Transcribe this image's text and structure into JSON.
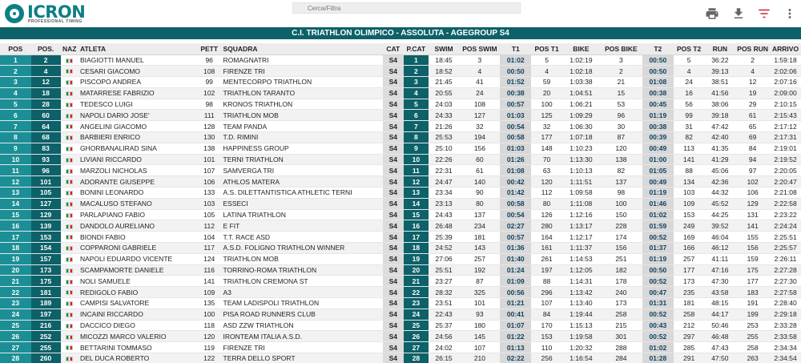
{
  "brand": {
    "name": "ICRON",
    "tagline": "PROFESSIONAL TIMING"
  },
  "search": {
    "placeholder": "Cerca/Filtra"
  },
  "title": "C.I. TRIATHLON OLIMPICO - ASSOLUTA - AGEGROUP S4",
  "icons": {
    "print": "print-icon",
    "download": "download-icon",
    "filter": "filter-icon",
    "menu": "menu-icon"
  },
  "colors": {
    "brand": "#0d7f86",
    "title_bar": "#0d6168",
    "pos_cell": "#1c8f96",
    "filter_icon": "#d2232a"
  },
  "headers": [
    "POS",
    "POS.",
    "NAZ",
    "ATLETA",
    "PETT",
    "SQUADRA",
    "CAT",
    "P.CAT",
    "SWIM",
    "POS SWIM",
    "T1",
    "POS T1",
    "BIKE",
    "POS BIKE",
    "T2",
    "POS T2",
    "RUN",
    "POS RUN",
    "ARRIVO"
  ],
  "rows": [
    [
      "1",
      "2",
      "",
      "BIAGIOTTI MANUEL",
      "96",
      "ROMAGNATRI",
      "S4",
      "1",
      "18:45",
      "3",
      "01:02",
      "5",
      "1:02:19",
      "3",
      "00:50",
      "5",
      "36:22",
      "2",
      "1:59:18"
    ],
    [
      "2",
      "4",
      "",
      "CESARI GIACOMO",
      "108",
      "FIRENZE TRI",
      "S4",
      "2",
      "18:52",
      "4",
      "00:50",
      "4",
      "1:02:18",
      "2",
      "00:50",
      "4",
      "39:13",
      "4",
      "2:02:06"
    ],
    [
      "3",
      "12",
      "",
      "PISCOPO ANDREA",
      "99",
      "MENTECORPO TRIATHLON",
      "S4",
      "3",
      "21:45",
      "41",
      "01:52",
      "59",
      "1:03:38",
      "21",
      "01:08",
      "24",
      "38:51",
      "12",
      "2:07:16"
    ],
    [
      "4",
      "18",
      "",
      "MATARRESE FABRIZIO",
      "102",
      "TRIATHLON TARANTO",
      "S4",
      "4",
      "20:55",
      "24",
      "00:38",
      "20",
      "1:04:51",
      "15",
      "00:38",
      "16",
      "41:56",
      "19",
      "2:09:00"
    ],
    [
      "5",
      "28",
      "",
      "TEDESCO LUIGI",
      "98",
      "KRONOS TRIATHLON",
      "S4",
      "5",
      "24:03",
      "108",
      "00:57",
      "100",
      "1:06:21",
      "53",
      "00:45",
      "56",
      "38:06",
      "29",
      "2:10:15"
    ],
    [
      "6",
      "60",
      "",
      "NAPOLI DARIO JOSE'",
      "111",
      "TRIATHLON MOB",
      "S4",
      "6",
      "24:33",
      "127",
      "01:03",
      "125",
      "1:09:29",
      "96",
      "01:19",
      "99",
      "39:18",
      "61",
      "2:15:43"
    ],
    [
      "7",
      "64",
      "",
      "ANGELINI GIACOMO",
      "128",
      "TEAM PANDA",
      "S4",
      "7",
      "21:26",
      "32",
      "00:54",
      "32",
      "1:06:30",
      "30",
      "00:38",
      "31",
      "47:42",
      "65",
      "2:17:12"
    ],
    [
      "8",
      "68",
      "",
      "BARBIERI ENRICO",
      "130",
      "T.D. RIMINI",
      "S4",
      "8",
      "25:53",
      "194",
      "00:58",
      "177",
      "1:07:18",
      "87",
      "00:39",
      "82",
      "42:40",
      "69",
      "2:17:31"
    ],
    [
      "9",
      "83",
      "",
      "GHORBANALIRAD SINA",
      "138",
      "HAPPINESS GROUP",
      "S4",
      "9",
      "25:10",
      "156",
      "01:03",
      "148",
      "1:10:23",
      "120",
      "00:49",
      "113",
      "41:35",
      "84",
      "2:19:01"
    ],
    [
      "10",
      "93",
      "",
      "LIVIANI RICCARDO",
      "101",
      "TERNI TRIATHLON",
      "S4",
      "10",
      "22:26",
      "60",
      "01:26",
      "70",
      "1:13:30",
      "138",
      "01:00",
      "141",
      "41:29",
      "94",
      "2:19:52"
    ],
    [
      "11",
      "96",
      "",
      "MARZOLI NICHOLAS",
      "107",
      "SAMVERGA TRI",
      "S4",
      "11",
      "22:31",
      "61",
      "01:08",
      "63",
      "1:10:13",
      "82",
      "01:05",
      "88",
      "45:06",
      "97",
      "2:20:05"
    ],
    [
      "12",
      "101",
      "",
      "ADORANTE GIUSEPPE",
      "106",
      "ATHLOS MATERA",
      "S4",
      "12",
      "24:47",
      "140",
      "00:42",
      "120",
      "1:11:51",
      "137",
      "00:49",
      "134",
      "42:36",
      "102",
      "2:20:47"
    ],
    [
      "13",
      "105",
      "",
      "BONINI LEONARDO",
      "133",
      "A.S. DILETTANTISTICA ATHLETIC TERNI",
      "S4",
      "13",
      "23:34",
      "90",
      "01:42",
      "112",
      "1:09:58",
      "98",
      "01:19",
      "103",
      "44:32",
      "106",
      "2:21:08"
    ],
    [
      "14",
      "127",
      "",
      "MACALUSO STEFANO",
      "103",
      "ESSECI",
      "S4",
      "14",
      "23:13",
      "80",
      "00:58",
      "80",
      "1:11:08",
      "100",
      "01:46",
      "109",
      "45:52",
      "129",
      "2:22:58"
    ],
    [
      "15",
      "129",
      "",
      "PARLAPIANO FABIO",
      "105",
      "LATINA TRIATHLON",
      "S4",
      "15",
      "24:43",
      "137",
      "00:54",
      "126",
      "1:12:16",
      "150",
      "01:02",
      "153",
      "44:25",
      "131",
      "2:23:22"
    ],
    [
      "16",
      "139",
      "",
      "DANDOLO AURELIANO",
      "112",
      "E FIT",
      "S4",
      "16",
      "26:48",
      "234",
      "02:27",
      "280",
      "1:13:17",
      "228",
      "01:59",
      "249",
      "39:52",
      "141",
      "2:24:24"
    ],
    [
      "17",
      "153",
      "",
      "BIONDI FABIO",
      "104",
      "T.T. RACE ASD",
      "S4",
      "17",
      "25:39",
      "181",
      "00:57",
      "164",
      "1:12:17",
      "174",
      "00:52",
      "169",
      "46:04",
      "155",
      "2:25:51"
    ],
    [
      "18",
      "154",
      "",
      "COPPARONI GABRIELE",
      "117",
      "A.S.D. FOLIGNO TRIATHLON WINNER",
      "S4",
      "18",
      "24:52",
      "143",
      "01:36",
      "161",
      "1:11:37",
      "156",
      "01:37",
      "166",
      "46:12",
      "156",
      "2:25:57"
    ],
    [
      "19",
      "157",
      "",
      "NAPOLI EDUARDO VICENTE",
      "124",
      "TRIATHLON MOB",
      "S4",
      "19",
      "27:06",
      "257",
      "01:40",
      "261",
      "1:14:53",
      "251",
      "01:19",
      "257",
      "41:11",
      "159",
      "2:26:11"
    ],
    [
      "20",
      "173",
      "",
      "SCAMPAMORTE DANIELE",
      "116",
      "TORRINO-ROMA TRIATHLON",
      "S4",
      "20",
      "25:51",
      "192",
      "01:24",
      "197",
      "1:12:05",
      "182",
      "00:50",
      "177",
      "47:16",
      "175",
      "2:27:28"
    ],
    [
      "21",
      "175",
      "",
      "NOLI SAMUELE",
      "141",
      "TRIATHLON CREMONA ST",
      "S4",
      "21",
      "23:27",
      "87",
      "01:09",
      "88",
      "1:14:31",
      "178",
      "00:52",
      "173",
      "47:30",
      "177",
      "2:27:30"
    ],
    [
      "22",
      "181",
      "",
      "REDIGOLO FABIO",
      "109",
      "A3",
      "S4",
      "22",
      "28:32",
      "325",
      "00:56",
      "296",
      "1:13:42",
      "240",
      "00:47",
      "235",
      "43:58",
      "183",
      "2:27:58"
    ],
    [
      "23",
      "189",
      "",
      "CAMPISI SALVATORE",
      "135",
      "TEAM LADISPOLI TRIATHLON",
      "S4",
      "23",
      "23:51",
      "101",
      "01:21",
      "107",
      "1:13:40",
      "173",
      "01:31",
      "181",
      "48:15",
      "191",
      "2:28:40"
    ],
    [
      "24",
      "197",
      "",
      "INCAINI RICCARDO",
      "100",
      "PISA ROAD RUNNERS CLUB",
      "S4",
      "24",
      "22:43",
      "93",
      "00:41",
      "84",
      "1:19:44",
      "258",
      "00:52",
      "258",
      "44:17",
      "199",
      "2:29:18"
    ],
    [
      "25",
      "216",
      "",
      "DACCICO DIEGO",
      "118",
      "ASD ZZW TRIATHLON",
      "S4",
      "25",
      "25:37",
      "180",
      "01:07",
      "170",
      "1:15:13",
      "215",
      "00:43",
      "212",
      "50:46",
      "253",
      "2:33:28"
    ],
    [
      "26",
      "252",
      "",
      "MICOZZI MARCO VALERIO",
      "120",
      "IRONTEAM ITALIA A.S.D.",
      "S4",
      "26",
      "24:56",
      "145",
      "01:22",
      "153",
      "1:19:58",
      "301",
      "00:52",
      "297",
      "46:48",
      "255",
      "2:33:58"
    ],
    [
      "27",
      "255",
      "",
      "BETTARINI TOMMASO",
      "119",
      "FIRENZE TRI",
      "S4",
      "27",
      "24:02",
      "107",
      "01:13",
      "110",
      "1:20:32",
      "288",
      "01:02",
      "285",
      "47:43",
      "258",
      "2:34:34"
    ],
    [
      "28",
      "260",
      "",
      "DEL DUCA ROBERTO",
      "122",
      "TERRA DELLO SPORT",
      "S4",
      "28",
      "26:15",
      "210",
      "02:22",
      "256",
      "1:16:54",
      "284",
      "01:28",
      "291",
      "47:50",
      "263",
      "2:34:54"
    ]
  ]
}
